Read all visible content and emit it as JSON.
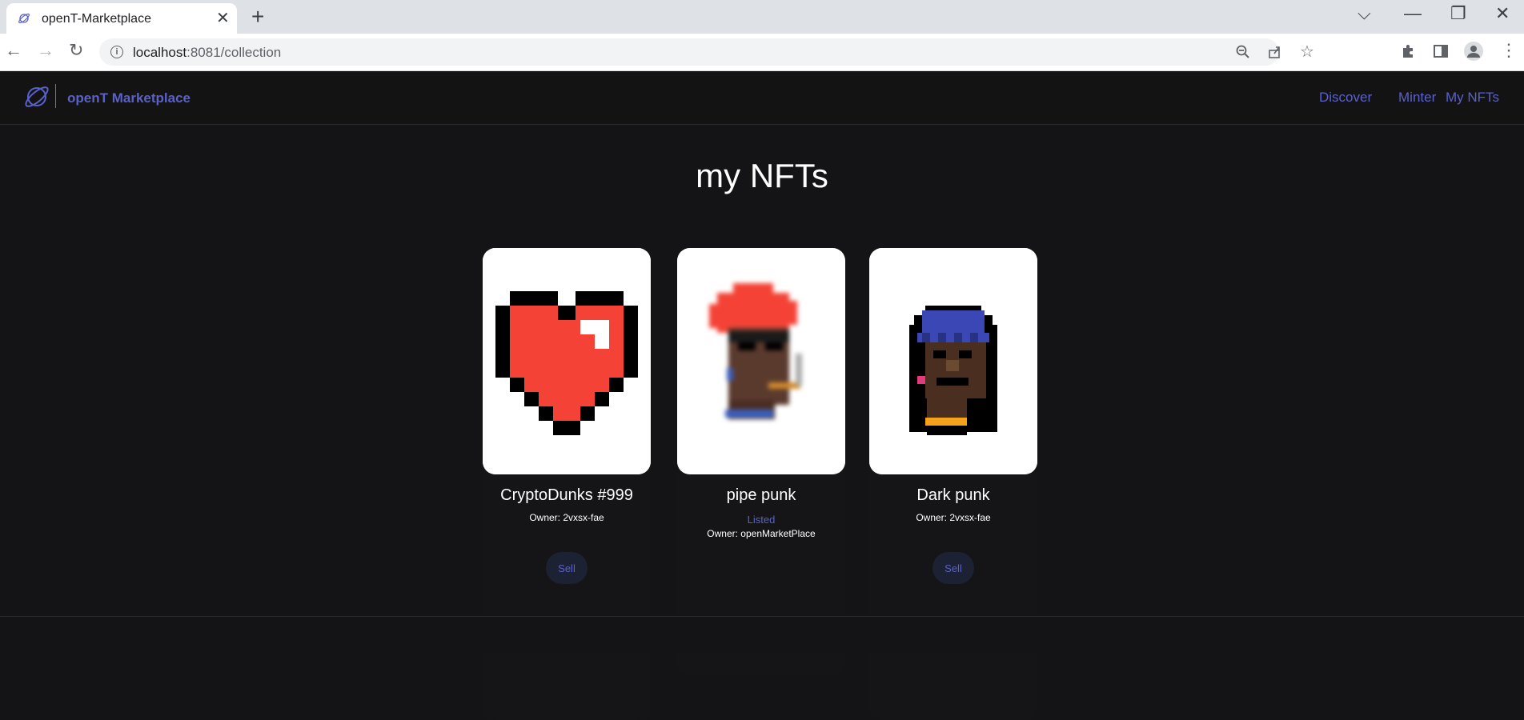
{
  "browser": {
    "tab_title": "openT-Marketplace",
    "tab_close": "✕",
    "new_tab": "+",
    "url_host": "localhost",
    "url_path": ":8081/collection",
    "controls": {
      "dropdown": "⌵",
      "minimize": "—",
      "restore": "❐",
      "close": "✕"
    }
  },
  "header": {
    "brand": "openT Marketplace",
    "nav": [
      "Discover",
      "Minter",
      "My NFTs"
    ]
  },
  "page": {
    "title": "my NFTs"
  },
  "nfts": [
    {
      "name": "CryptoDunks #999",
      "owner": "Owner: 2vxsx-fae",
      "button": "Sell"
    },
    {
      "name": "pipe punk",
      "status": "Listed",
      "owner": "Owner: openMarketPlace"
    },
    {
      "name": "Dark punk",
      "owner": "Owner: 2vxsx-fae",
      "button": "Sell"
    }
  ],
  "colors": {
    "accent": "#5a61c9",
    "background": "#141416",
    "heart_red": "#f44336"
  }
}
